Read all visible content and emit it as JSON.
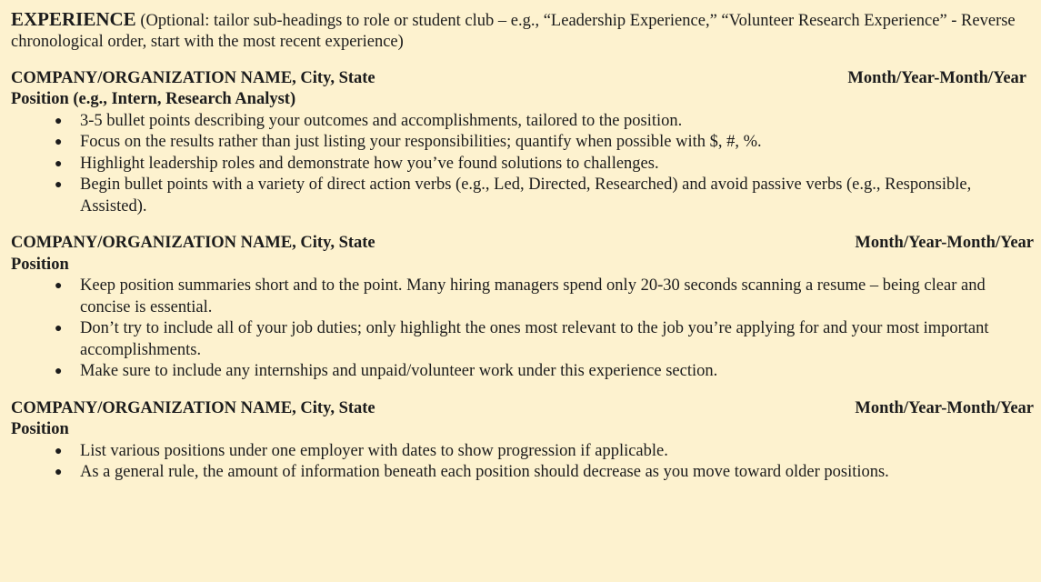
{
  "section": {
    "title": "EXPERIENCE",
    "note": " (Optional: tailor sub-headings to role or student club – e.g., “Leadership Experience,” “Volunteer Research Experience” - Reverse chronological order, start with the most recent experience)"
  },
  "entries": [
    {
      "organization": "COMPANY/ORGANIZATION NAME, City, State",
      "dates": "Month/Year-Month/Year",
      "position": "Position (e.g., Intern, Research Analyst)",
      "bullets": [
        "3-5 bullet points describing your outcomes and accomplishments, tailored to the position.",
        "Focus on the results rather than just listing your responsibilities; quantify when possible with $, #, %.",
        "Highlight leadership roles and demonstrate how you’ve found solutions to challenges.",
        "Begin bullet points with a variety of direct action verbs (e.g., Led, Directed, Researched) and avoid passive verbs (e.g., Responsible, Assisted)."
      ]
    },
    {
      "organization": "COMPANY/ORGANIZATION NAME, City, State",
      "dates": "Month/Year-Month/Year",
      "position": "Position",
      "bullets": [
        "Keep position summaries short and to the point. Many hiring managers spend only 20-30 seconds scanning a resume – being clear and concise is essential.",
        "Don’t try to include all of your job duties; only highlight the ones most relevant to the job you’re applying for and your most important accomplishments.",
        "Make sure to include any internships and unpaid/volunteer work under this experience section."
      ]
    },
    {
      "organization": "COMPANY/ORGANIZATION NAME, City, State",
      "dates": "Month/Year-Month/Year",
      "position": "Position",
      "bullets": [
        "List various positions under one employer with dates to show progression if applicable.",
        "As a general rule, the amount of information beneath each position should decrease as you move toward older positions."
      ]
    }
  ],
  "bullet_glyph": "●"
}
